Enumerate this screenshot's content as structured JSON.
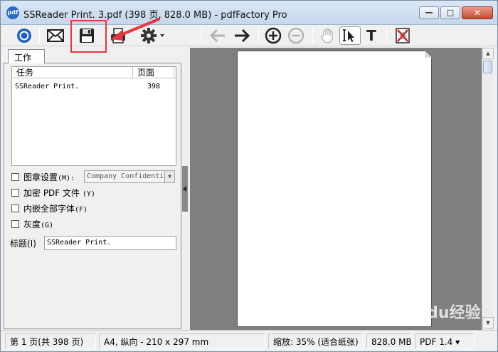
{
  "window": {
    "app_icon_text": "pdf",
    "title": "SSReader Print. 3.pdf (398 页, 828.0 MB) - pdfFactory Pro",
    "minimize_glyph": "—",
    "maximize_glyph": "□",
    "close_glyph": "✕"
  },
  "toolbar": {
    "icons": [
      "view-icon",
      "email-icon",
      "save-icon",
      "print-icon",
      "settings-icon",
      "back-arrow-icon",
      "forward-arrow-icon",
      "zoom-in-icon",
      "zoom-out-icon",
      "hand-icon",
      "select-icon",
      "text-icon",
      "delete-page-icon"
    ],
    "text_tool_glyph": "T",
    "annotation_color": "#e8383d"
  },
  "left_panel": {
    "tab_label": "工作",
    "list": {
      "headers": {
        "task": "任务",
        "pages": "页面"
      },
      "rows": [
        {
          "task": "SSReader Print.",
          "pages": "398"
        }
      ]
    },
    "options": {
      "stamp": {
        "label": "图章设置",
        "shortcut": "(M):",
        "checked": false,
        "combo_value": "Company Confidenti",
        "combo_arrow": "▼"
      },
      "encrypt": {
        "label": "加密 PDF 文件",
        "shortcut": "(Y)",
        "checked": false
      },
      "embed_fonts": {
        "label": "内嵌全部字体",
        "shortcut": "(F)",
        "checked": false
      },
      "grayscale": {
        "label": "灰度",
        "shortcut": "(G)",
        "checked": false
      }
    },
    "title_field": {
      "label": "标题(I)",
      "value": "SSReader Print."
    }
  },
  "scrollbar": {
    "up_glyph": "▲",
    "down_glyph": "▼"
  },
  "statusbar": {
    "page": "第 1 页(共 398 页)",
    "paper": "A4, 纵向 - 210 x 297 mm",
    "zoom": "缩放: 35% (适合纸张)",
    "size": "828.0 MB",
    "pdf_version": "PDF 1.4 ▾"
  },
  "watermark": {
    "text": "Baidu经验"
  }
}
